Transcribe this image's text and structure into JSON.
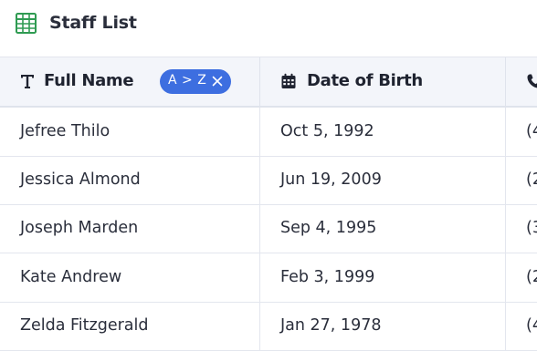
{
  "app": {
    "title": "Staff List",
    "icon": "spreadsheet-icon",
    "accent_color": "#3d6ee0",
    "icon_color": "#2f9b52"
  },
  "columns": [
    {
      "label": "Full Name",
      "icon": "text-type-icon",
      "sort": {
        "label": "A > Z"
      }
    },
    {
      "label": "Date of Birth",
      "icon": "calendar-icon"
    },
    {
      "label": "",
      "icon": "phone-icon"
    }
  ],
  "rows": [
    {
      "name": "Jefree Thilo",
      "dob": "Oct 5, 1992",
      "phone": "(4"
    },
    {
      "name": "Jessica Almond",
      "dob": "Jun 19, 2009",
      "phone": "(2"
    },
    {
      "name": "Joseph Marden",
      "dob": "Sep 4, 1995",
      "phone": "(3"
    },
    {
      "name": "Kate Andrew",
      "dob": "Feb 3, 1999",
      "phone": "(2"
    },
    {
      "name": "Zelda Fitzgerald",
      "dob": "Jan 27, 1978",
      "phone": "(4"
    }
  ]
}
